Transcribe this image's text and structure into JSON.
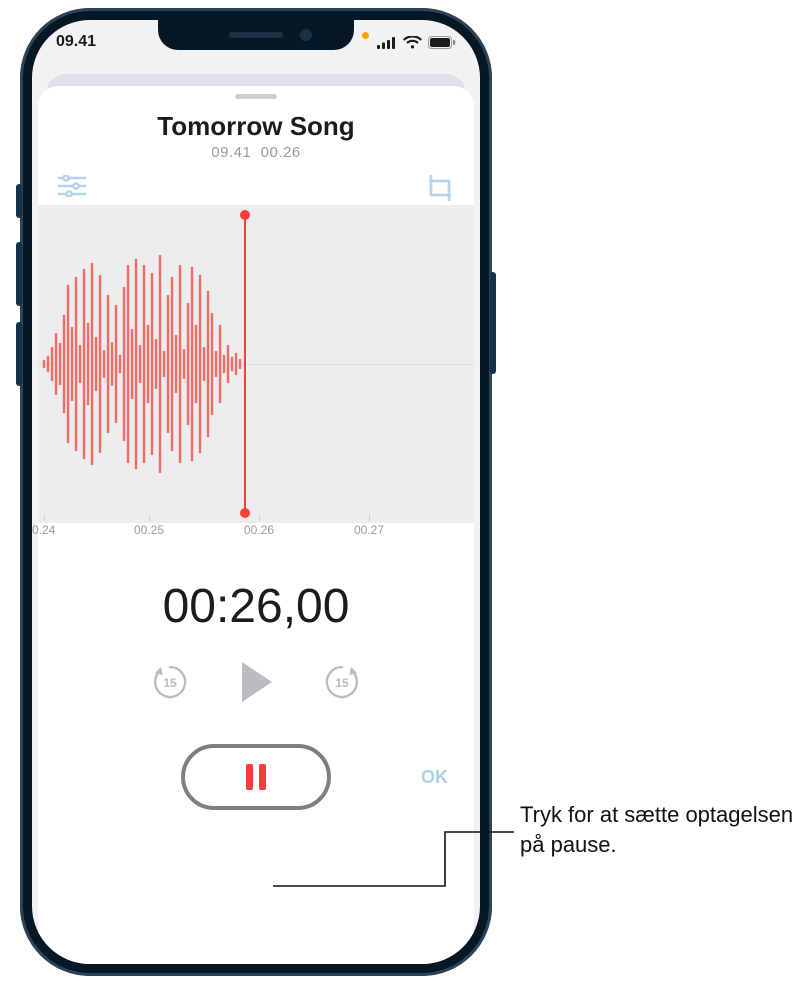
{
  "statusbar": {
    "time": "09.41"
  },
  "recording": {
    "title": "Tomorrow Song",
    "time_of_day": "09.41",
    "duration_short": "00.26",
    "elapsed": "00:26,00"
  },
  "ruler": {
    "t0": "0.24",
    "t1": "00.25",
    "t2": "00.26",
    "t3": "00.27"
  },
  "transport": {
    "skip_back_seconds": "15",
    "skip_fwd_seconds": "15"
  },
  "buttons": {
    "done": "OK"
  },
  "callout": {
    "text": "Tryk for at sætte optagelsen på pause."
  }
}
